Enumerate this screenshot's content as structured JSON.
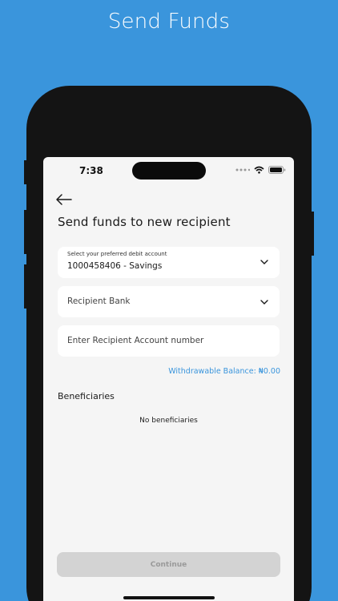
{
  "promo": {
    "title": "Send Funds"
  },
  "status_bar": {
    "time": "7:38",
    "icons": [
      "signal-dots-icon",
      "wifi-icon",
      "battery-icon"
    ]
  },
  "header": {
    "back_icon": "arrow-left-icon",
    "title": "Send funds to new recipient"
  },
  "form": {
    "debit_account": {
      "caption": "Select your preferred debit account",
      "value": "1000458406 - Savings"
    },
    "recipient_bank": {
      "placeholder": "Recipient Bank"
    },
    "account_number": {
      "placeholder": "Enter Recipient Account number"
    }
  },
  "balance": {
    "label": "Withdrawable Balance: ₦0.00"
  },
  "beneficiaries": {
    "title": "Beneficiaries",
    "empty_text": "No beneficiaries"
  },
  "actions": {
    "continue_label": "Continue"
  },
  "colors": {
    "background": "#3a95dc",
    "accent": "#3a95dc",
    "button_disabled": "#d3d3d3"
  }
}
